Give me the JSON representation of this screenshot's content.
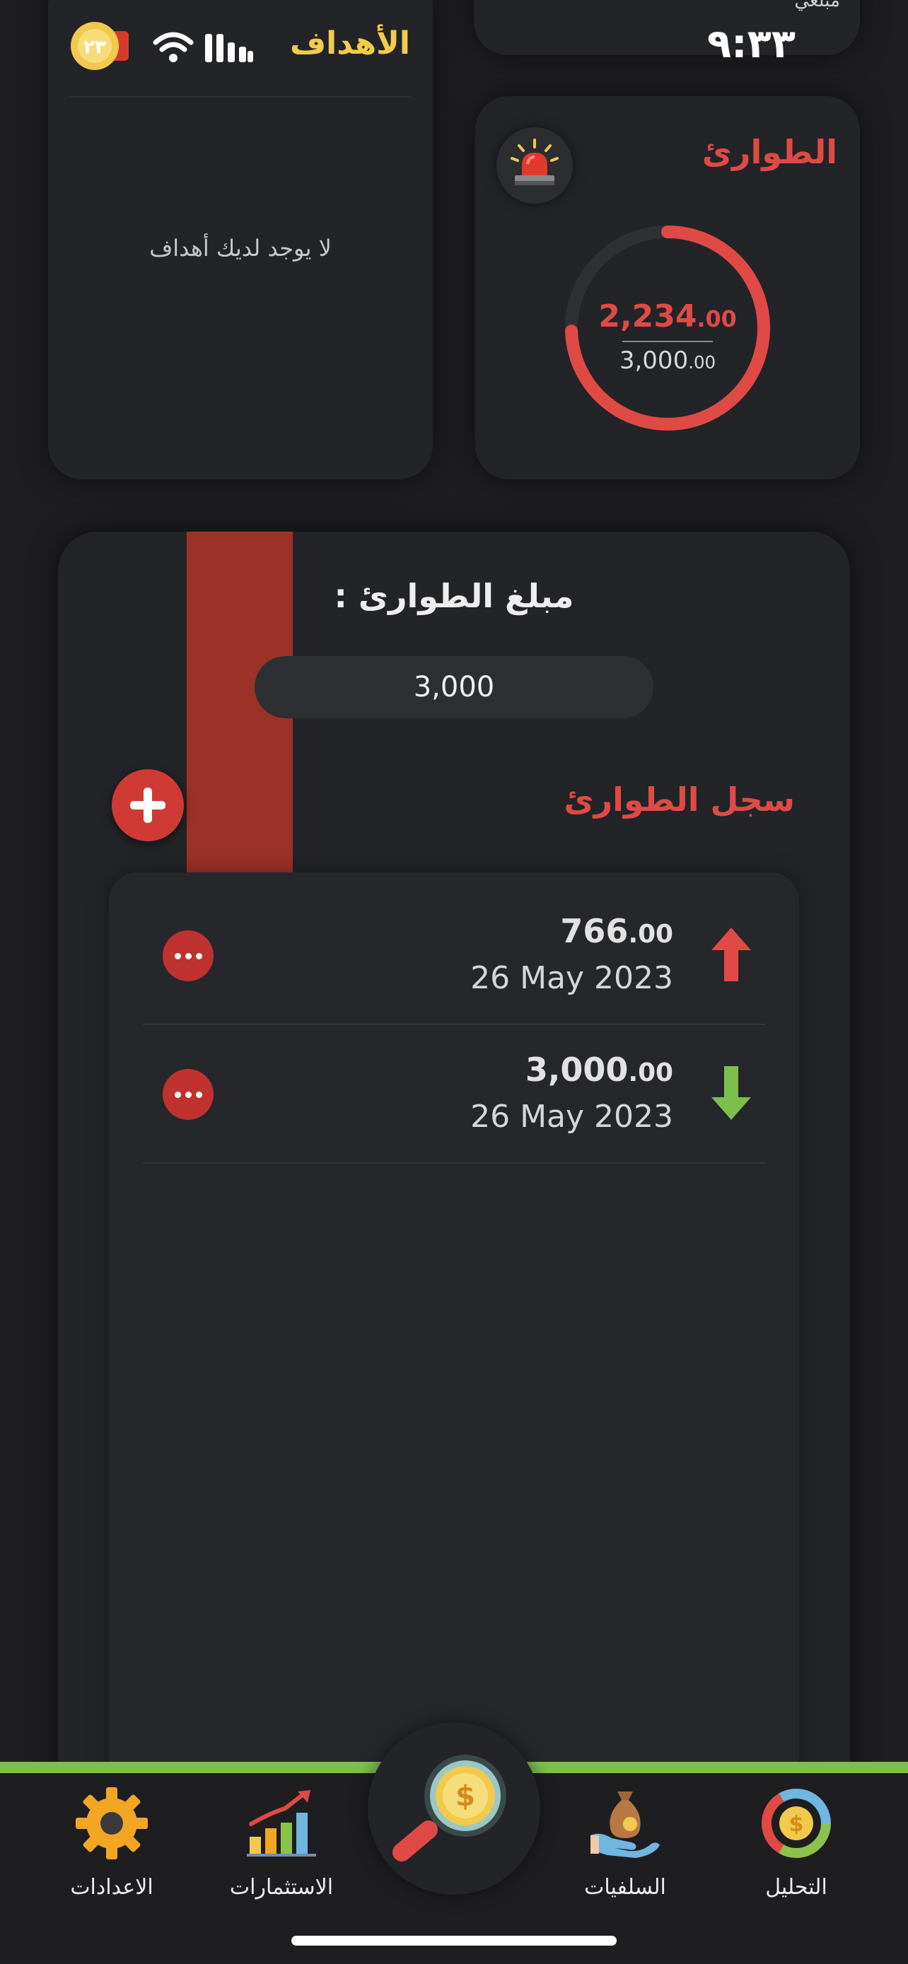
{
  "status_bar": {
    "time": "٩:٣٣",
    "battery_level": "٢٣",
    "icons": [
      "cellular-icon",
      "wifi-icon",
      "battery-icon"
    ]
  },
  "goals_card": {
    "title": "الأهداف",
    "empty_message": "لا يوجد لديك أهداف"
  },
  "budget_card": {
    "label": "مبلغي"
  },
  "emergency_card": {
    "title": "الطوارئ",
    "icon": "siren-icon",
    "spent_int": "2,234",
    "spent_dec": ".00",
    "total_int": "3,000",
    "total_dec": ".00",
    "progress": 0.7447,
    "color": "#e04a45"
  },
  "detail": {
    "amount_label": "مبلغ الطوارئ :",
    "amount_value": "3,000",
    "log_title": "سجل الطوارئ",
    "entries": [
      {
        "amount_int": "766",
        "amount_dec": ".00",
        "date": "26 May 2023",
        "direction": "up",
        "direction_icon": "arrow-up-icon",
        "color": "#e04a45"
      },
      {
        "amount_int": "3,000",
        "amount_dec": ".00",
        "date": "26 May 2023",
        "direction": "down",
        "direction_icon": "arrow-down-icon",
        "color": "#7cc04b"
      }
    ]
  },
  "bottom_nav": {
    "center_icon": "dollar-search-icon",
    "items": [
      {
        "label": "الاعدادات",
        "icon": "gear-icon"
      },
      {
        "label": "الاستثمارات",
        "icon": "investment-chart-icon"
      },
      {
        "label": "السلفيات",
        "icon": "money-bag-hand-icon"
      },
      {
        "label": "التحليل",
        "icon": "analysis-donut-icon"
      }
    ]
  },
  "colors": {
    "background": "#1e1e21",
    "card": "#232428",
    "accent_red": "#e04a45",
    "accent_yellow": "#f2cc4a",
    "accent_green": "#7cc04b"
  }
}
